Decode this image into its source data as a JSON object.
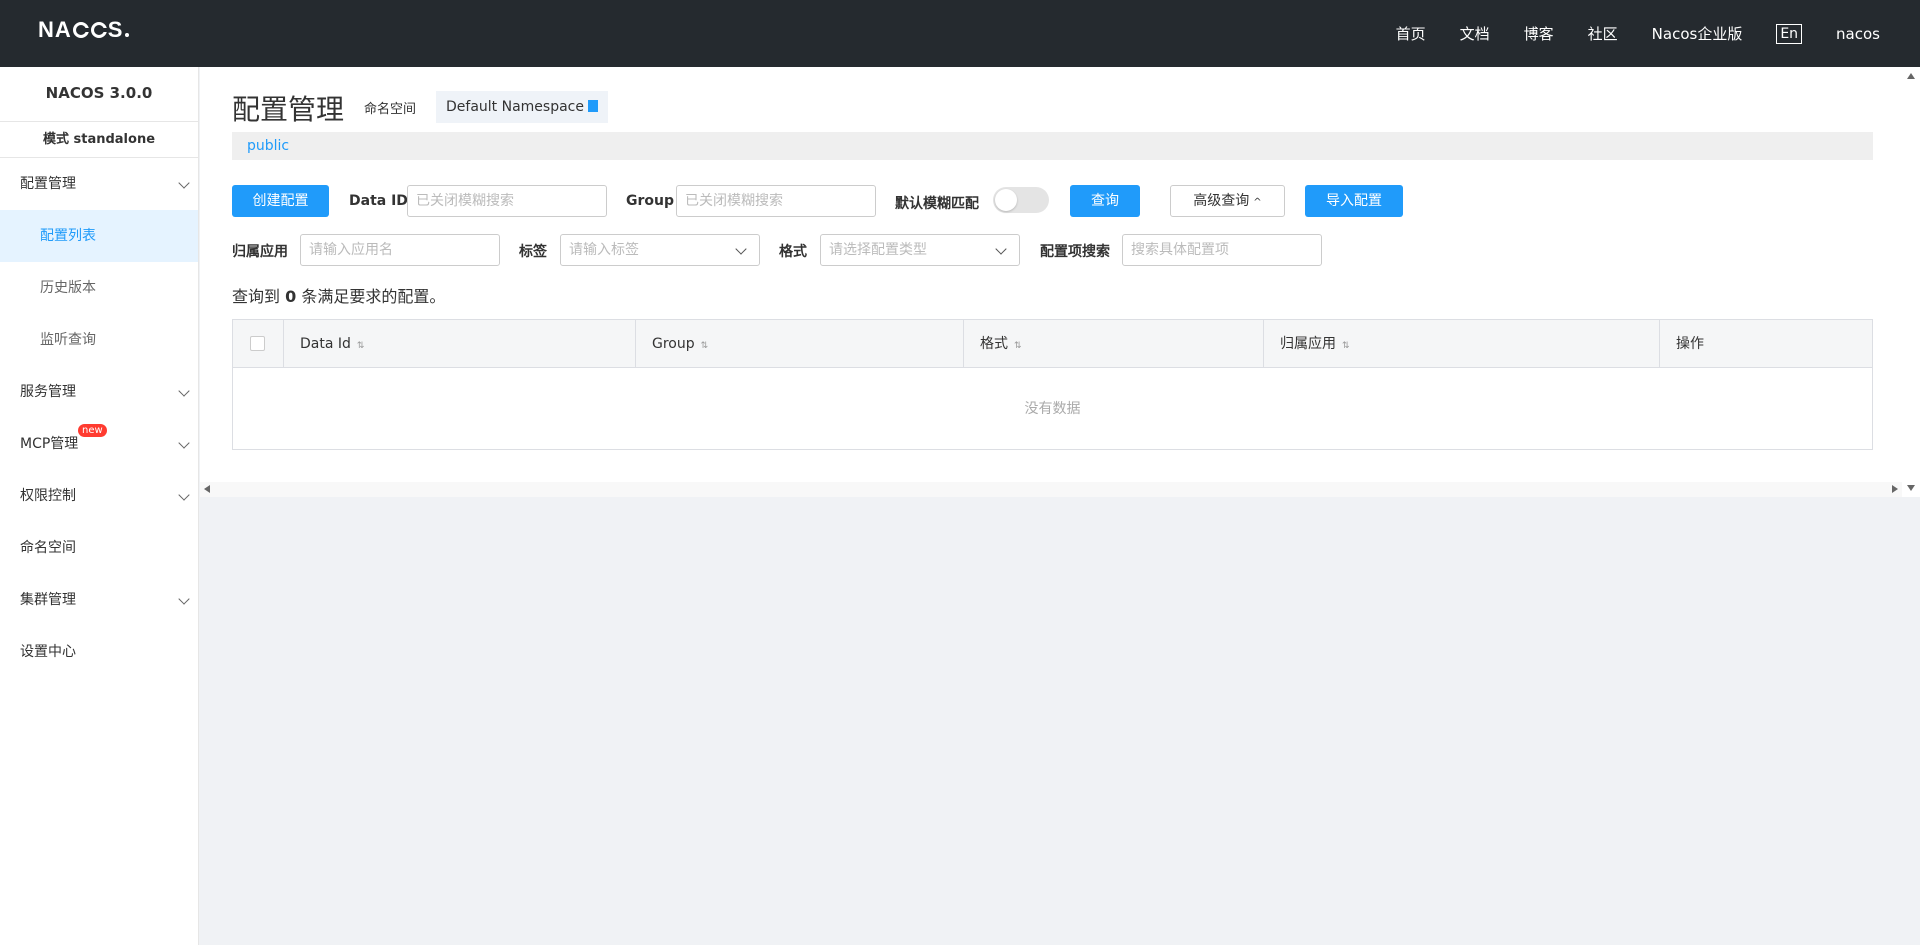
{
  "header": {
    "logo": "NACOS",
    "nav": [
      "首页",
      "文档",
      "博客",
      "社区",
      "Nacos企业版"
    ],
    "lang": "En",
    "user": "nacos"
  },
  "sidebar": {
    "version": "NACOS 3.0.0",
    "mode": "模式 standalone",
    "items": [
      {
        "label": "配置管理",
        "expandable": true
      },
      {
        "label": "配置列表",
        "sub": true,
        "active": true
      },
      {
        "label": "历史版本",
        "sub": true
      },
      {
        "label": "监听查询",
        "sub": true
      },
      {
        "label": "服务管理",
        "expandable": true
      },
      {
        "label": "MCP管理",
        "expandable": true,
        "badge": "new"
      },
      {
        "label": "权限控制",
        "expandable": true
      },
      {
        "label": "命名空间"
      },
      {
        "label": "集群管理",
        "expandable": true
      },
      {
        "label": "设置中心"
      }
    ]
  },
  "page": {
    "title": "配置管理",
    "namespace_label": "命名空间",
    "namespace_value": "Default Namespace",
    "namespace_tab": "public"
  },
  "toolbar": {
    "create_label": "创建配置",
    "dataid_label": "Data ID",
    "dataid_placeholder": "已关闭模糊搜索",
    "group_label": "Group",
    "group_placeholder": "已关闭模糊搜索",
    "fuzzy_label": "默认模糊匹配",
    "search_label": "查询",
    "advanced_label": "高级查询",
    "import_label": "导入配置",
    "app_label": "归属应用",
    "app_placeholder": "请输入应用名",
    "tag_label": "标签",
    "tag_placeholder": "请输入标签",
    "format_label": "格式",
    "format_placeholder": "请选择配置类型",
    "item_label": "配置项搜索",
    "item_placeholder": "搜索具体配置项"
  },
  "result": {
    "prefix": "查询到",
    "count": "0",
    "suffix": "条满足要求的配置。"
  },
  "table": {
    "columns": [
      "Data Id",
      "Group",
      "格式",
      "归属应用",
      "操作"
    ],
    "empty_text": "没有数据"
  },
  "colors": {
    "accent": "#209bfa",
    "header_bg": "#252a2f"
  }
}
